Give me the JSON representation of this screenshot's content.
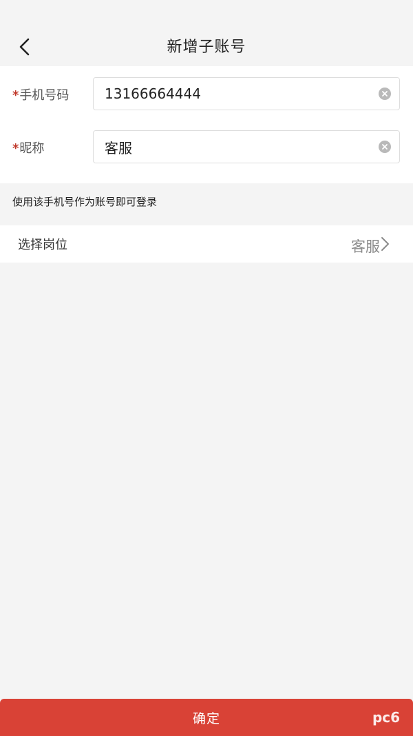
{
  "header": {
    "title": "新增子账号",
    "back_icon": "chevron-left-icon"
  },
  "form": {
    "phone": {
      "required_mark": "*",
      "label": "手机号码",
      "value": "13166664444"
    },
    "nickname": {
      "required_mark": "*",
      "label": "昵称",
      "value": "客服"
    }
  },
  "hint": "使用该手机号作为账号即可登录",
  "position": {
    "label": "选择岗位",
    "value": "客服"
  },
  "confirm": {
    "label": "确定"
  },
  "watermark": {
    "text": "pc6"
  },
  "colors": {
    "accent": "#d94236",
    "required": "#c0392b",
    "background": "#f4f4f4"
  }
}
